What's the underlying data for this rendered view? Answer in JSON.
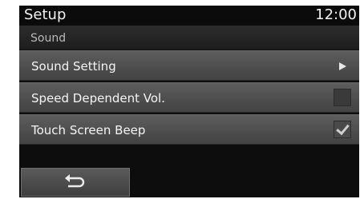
{
  "header": {
    "title": "Setup",
    "clock": "12:00"
  },
  "section": {
    "title": "Sound"
  },
  "menu": {
    "items": [
      {
        "label": "Sound Setting",
        "control": "arrow-right-icon"
      },
      {
        "label": "Speed Dependent Vol.",
        "control": "checkbox",
        "checked": false
      },
      {
        "label": "Touch Screen Beep",
        "control": "checkbox",
        "checked": true
      }
    ]
  },
  "footer": {
    "back_icon": "back-arrow-icon"
  }
}
